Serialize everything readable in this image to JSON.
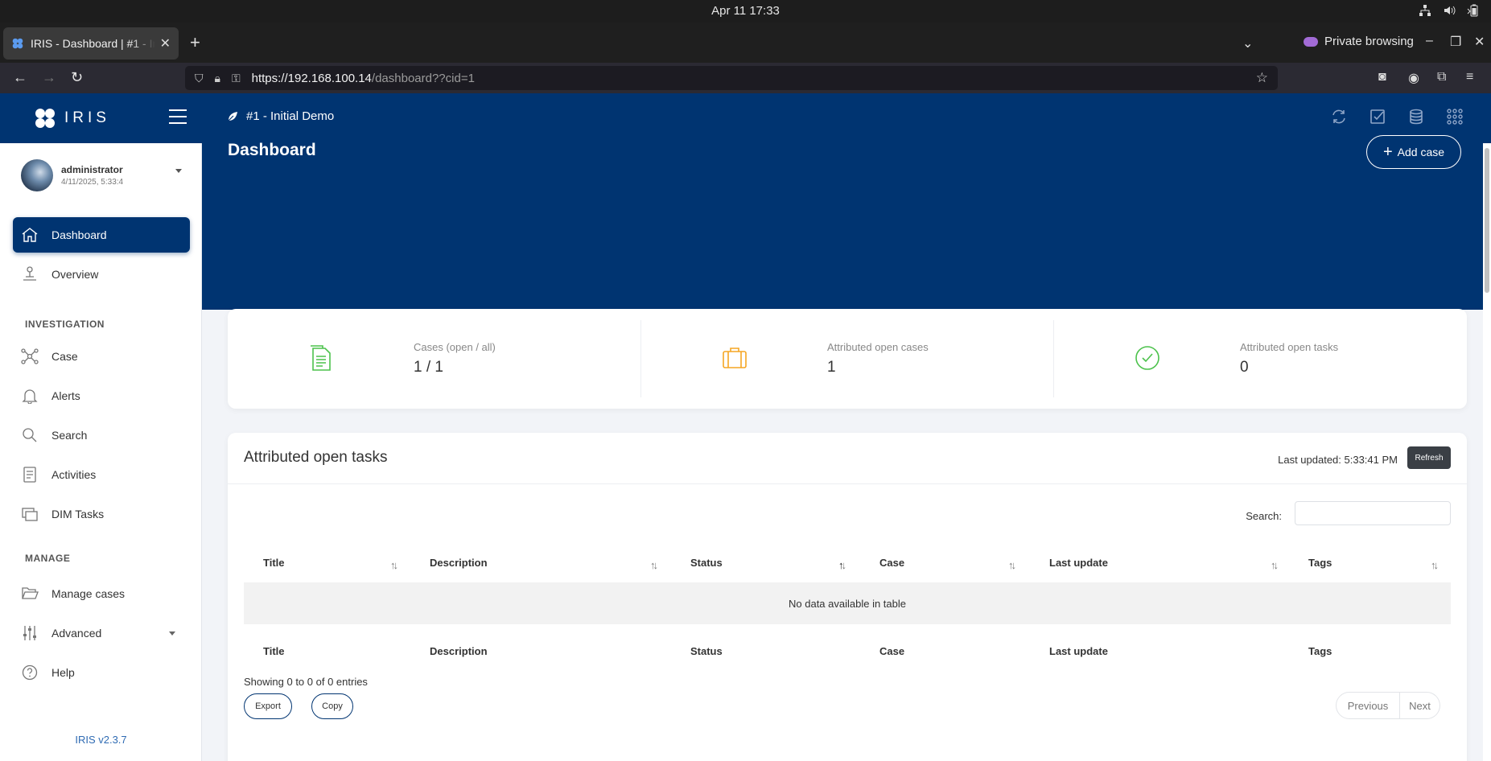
{
  "os": {
    "clock": "Apr 11  17:33"
  },
  "browser": {
    "tab_title": "IRIS - Dashboard | #1 - Initial Demo",
    "private_label": "Private browsing",
    "url_host": "https://192.168.100.14",
    "url_path": "/dashboard??cid=1"
  },
  "app": {
    "logo_text": "IRIS",
    "case_name": "#1 - Initial Demo",
    "user": {
      "name": "administrator",
      "login_time": "4/11/2025, 5:33:4"
    },
    "nav": {
      "dashboard": "Dashboard",
      "overview": "Overview",
      "section_investigation": "INVESTIGATION",
      "case": "Case",
      "alerts": "Alerts",
      "search": "Search",
      "activities": "Activities",
      "dim_tasks": "DIM Tasks",
      "section_manage": "MANAGE",
      "manage_cases": "Manage cases",
      "advanced": "Advanced",
      "help": "Help"
    },
    "version": "IRIS v2.3.7",
    "accent_color": "#003471"
  },
  "dashboard": {
    "title": "Dashboard",
    "add_case_label": "Add case",
    "stats": [
      {
        "label": "Cases (open / all)",
        "value": "1 / 1",
        "icon": "document-icon",
        "color": "#4cc24c"
      },
      {
        "label": "Attributed open cases",
        "value": "1",
        "icon": "briefcase-icon",
        "color": "#f5a623"
      },
      {
        "label": "Attributed open tasks",
        "value": "0",
        "icon": "check-circle-icon",
        "color": "#4cc24c"
      }
    ]
  },
  "tasks": {
    "title": "Attributed open tasks",
    "last_updated": "Last updated: 5:33:41 PM",
    "refresh_label": "Refresh",
    "search_label": "Search:",
    "search_value": "",
    "columns": [
      "Title",
      "Description",
      "Status",
      "Case",
      "Last update",
      "Tags"
    ],
    "empty_message": "No data available in table",
    "showing": "Showing 0 to 0 of 0 entries",
    "export_label": "Export",
    "copy_label": "Copy",
    "previous_label": "Previous",
    "next_label": "Next"
  }
}
